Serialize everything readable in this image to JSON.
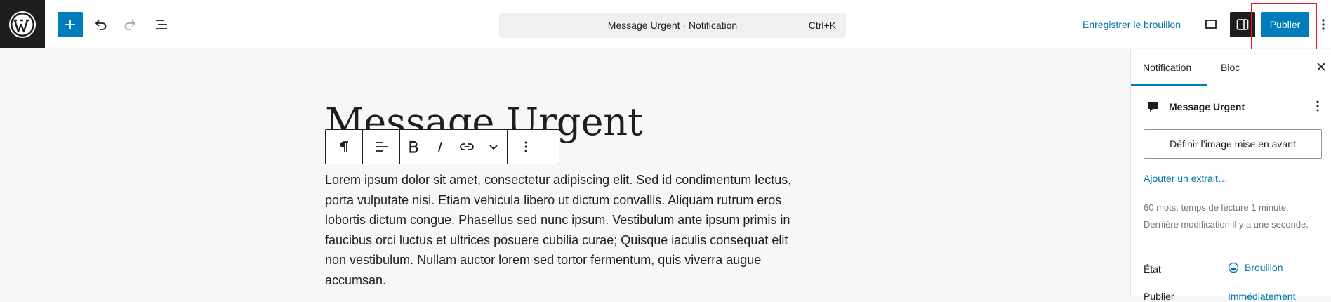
{
  "header": {
    "command_title": "Message Urgent · Notification",
    "command_shortcut": "Ctrl+K",
    "save_draft_label": "Enregistrer le brouillon",
    "publish_label": "Publier",
    "accent_color": "#007cba"
  },
  "editor": {
    "post_title": "Message Urgent",
    "paragraph": "Lorem ipsum dolor sit amet, consectetur adipiscing elit. Sed id condimentum lectus, porta vulputate nisi. Etiam vehicula libero ut dictum convallis. Aliquam rutrum eros lobortis dictum congue. Phasellus sed nunc ipsum. Vestibulum ante ipsum primis in faucibus orci luctus et ultrices posuere cubilia curae; Quisque iaculis consequat elit non vestibulum. Nullam auctor lorem sed tortor fermentum, quis viverra augue accumsan.",
    "block_toolbar_icons": [
      "paragraph-icon",
      "align-left-icon",
      "bold-icon",
      "italic-icon",
      "link-icon",
      "chevron-down-icon",
      "more-vertical-icon"
    ]
  },
  "sidebar": {
    "tabs": [
      "Notification",
      "Bloc"
    ],
    "active_tab": "Notification",
    "post_title": "Message Urgent",
    "featured_image_label": "Définir l’image mise en avant",
    "excerpt_link": "Ajouter un extrait…",
    "reading_info": "60 mots, temps de lecture 1 minute.",
    "last_modified": "Dernière modification il y a une seconde.",
    "status_label": "État",
    "status_value": "Brouillon",
    "publish_label": "Publier",
    "publish_value": "Immédiatement"
  },
  "icons": {
    "logo": "wordpress-logo-icon",
    "add": "plus-icon",
    "undo": "undo-icon",
    "redo": "redo-icon",
    "list_view": "list-view-icon",
    "view": "laptop-icon",
    "settings": "sidebar-toggle-icon",
    "options": "more-vertical-icon",
    "close": "close-icon",
    "post_type": "speech-bubble-icon",
    "status": "draft-status-icon"
  }
}
